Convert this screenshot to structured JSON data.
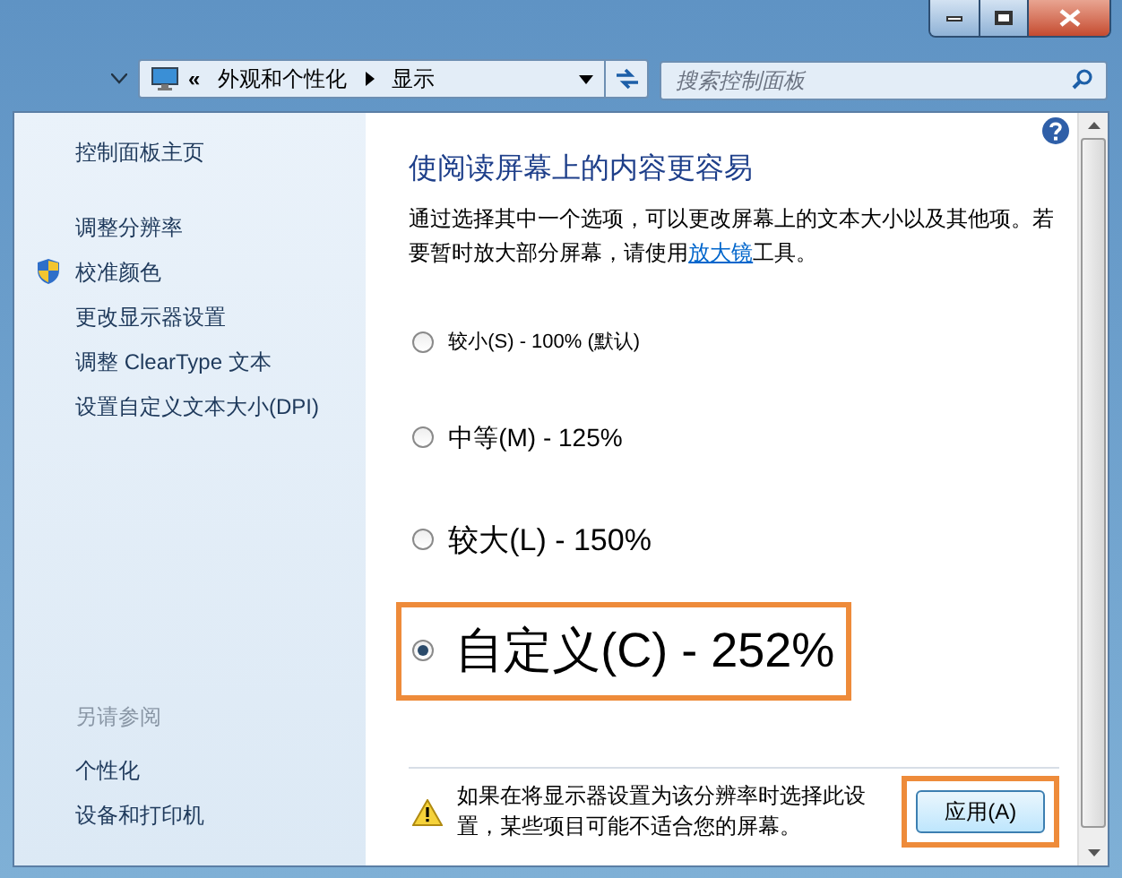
{
  "address_bar": {
    "overflow": "«",
    "crumbs": [
      "外观和个性化",
      "显示"
    ]
  },
  "search": {
    "placeholder": "搜索控制面板"
  },
  "sidebar": {
    "home": "控制面板主页",
    "links": [
      {
        "label": "调整分辨率",
        "kind": "plain"
      },
      {
        "label": "校准颜色",
        "kind": "shield"
      },
      {
        "label": "更改显示器设置",
        "kind": "plain"
      },
      {
        "label": "调整 ClearType 文本",
        "kind": "plain"
      },
      {
        "label": "设置自定义文本大小(DPI)",
        "kind": "plain"
      }
    ],
    "see_also_title": "另请参阅",
    "see_also": [
      "个性化",
      "设备和打印机"
    ]
  },
  "main": {
    "heading": "使阅读屏幕上的内容更容易",
    "intro_before": "通过选择其中一个选项，可以更改屏幕上的文本大小以及其他项。若要暂时放大部分屏幕，请使用",
    "intro_link": "放大镜",
    "intro_after": "工具。",
    "options": [
      {
        "label": "较小(S) - 100% (默认)",
        "selected": false,
        "highlighted": false
      },
      {
        "label": "中等(M) - 125%",
        "selected": false,
        "highlighted": false
      },
      {
        "label": "较大(L) - 150%",
        "selected": false,
        "highlighted": false
      },
      {
        "label": "自定义(C) - 252%",
        "selected": true,
        "highlighted": true
      }
    ],
    "warning": "如果在将显示器设置为该分辨率时选择此设置，某些项目可能不适合您的屏幕。",
    "apply_button": {
      "label": "应用(A)",
      "highlighted": true
    }
  }
}
